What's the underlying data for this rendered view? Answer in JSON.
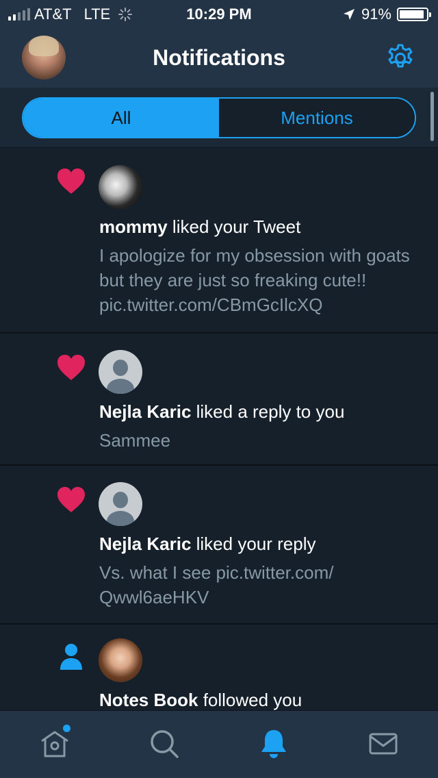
{
  "status_bar": {
    "carrier": "AT&T",
    "network": "LTE",
    "time": "10:29 PM",
    "battery": "91%",
    "battery_level": 0.91
  },
  "header": {
    "title": "Notifications",
    "settings_icon": "gear-icon"
  },
  "tabs": {
    "all_label": "All",
    "mentions_label": "Mentions",
    "selected": "All"
  },
  "notifications": [
    {
      "icon": "heart-icon",
      "user": "mommy",
      "action": " liked your Tweet",
      "detail": "I apologize for my obsession with goats but they are just so freaking cute!! pic.twitter.com/CBmGcIlcXQ"
    },
    {
      "icon": "heart-icon",
      "user": "Nejla Karic",
      "action": " liked a reply to you",
      "detail": "Sammee"
    },
    {
      "icon": "heart-icon",
      "user": "Nejla Karic",
      "action": " liked your reply",
      "detail": "Vs. what I see pic.twitter.com/ Qwwl6aeHKV"
    },
    {
      "icon": "person-icon",
      "user": "Notes Book",
      "action": " followed you",
      "detail": ""
    }
  ],
  "tab_bar": {
    "items": [
      "home-icon",
      "search-icon",
      "bell-icon",
      "mail-icon"
    ],
    "active": "bell-icon"
  },
  "colors": {
    "accent": "#1da1f2",
    "like": "#e0245e",
    "background": "#15202b",
    "header": "#243447"
  }
}
